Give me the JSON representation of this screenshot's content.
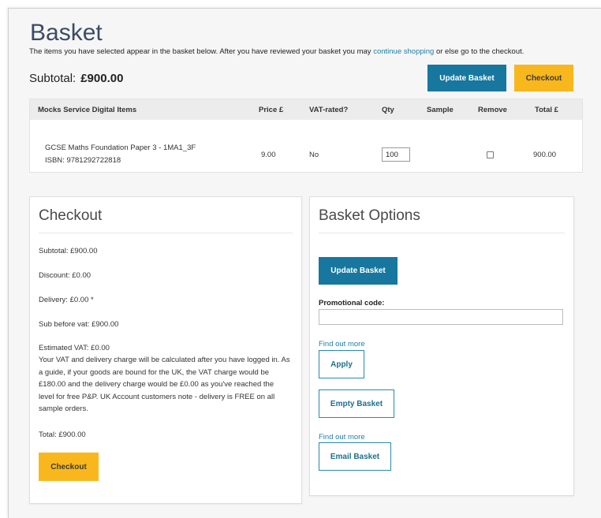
{
  "page": {
    "title": "Basket",
    "intro_before": "The items you have selected appear in the basket below. After you have reviewed your basket you may ",
    "intro_link": "continue shopping",
    "intro_after": " or else go to the checkout.",
    "subtotal_label": "Subtotal:",
    "subtotal_value": "£900.00",
    "update_basket_label": "Update Basket",
    "checkout_label": "Checkout"
  },
  "table": {
    "headers": [
      "Mocks Service Digital Items",
      "Price £",
      "VAT-rated?",
      "Qty",
      "Sample",
      "Remove",
      "Total £"
    ],
    "rows": [
      {
        "title": "GCSE Maths Foundation Paper 3 - 1MA1_3F",
        "isbn": "ISBN: 9781292722818",
        "price": "9.00",
        "vat": "No",
        "qty": "100",
        "total": "900.00"
      }
    ]
  },
  "checkout_panel": {
    "title": "Checkout",
    "subtotal": "Subtotal: £900.00",
    "discount": "Discount: £0.00",
    "delivery": "Delivery: £0.00 *",
    "sub_before_vat": "Sub before vat: £900.00",
    "estimated_vat": "Estimated VAT: £0.00",
    "note": "Your VAT and delivery charge will be calculated after you have logged in. As a guide, if your goods are bound for the UK, the VAT charge would be £180.00 and the delivery charge would be £0.00 as you've reached the level for free P&P. UK Account customers note - delivery is FREE on all sample orders.",
    "total": "Total: £900.00",
    "button_label": "Checkout"
  },
  "options_panel": {
    "title": "Basket Options",
    "update_label": "Update Basket",
    "promo_label": "Promotional code:",
    "promo_value": "",
    "find_out_more_1": "Find out more",
    "apply_label": "Apply",
    "empty_label": "Empty Basket",
    "find_out_more_2": "Find out more",
    "email_label": "Email Basket"
  },
  "colors": {
    "primary_blue": "#17779e",
    "accent_yellow": "#f9b71e",
    "link_blue": "#1f7ea8"
  }
}
